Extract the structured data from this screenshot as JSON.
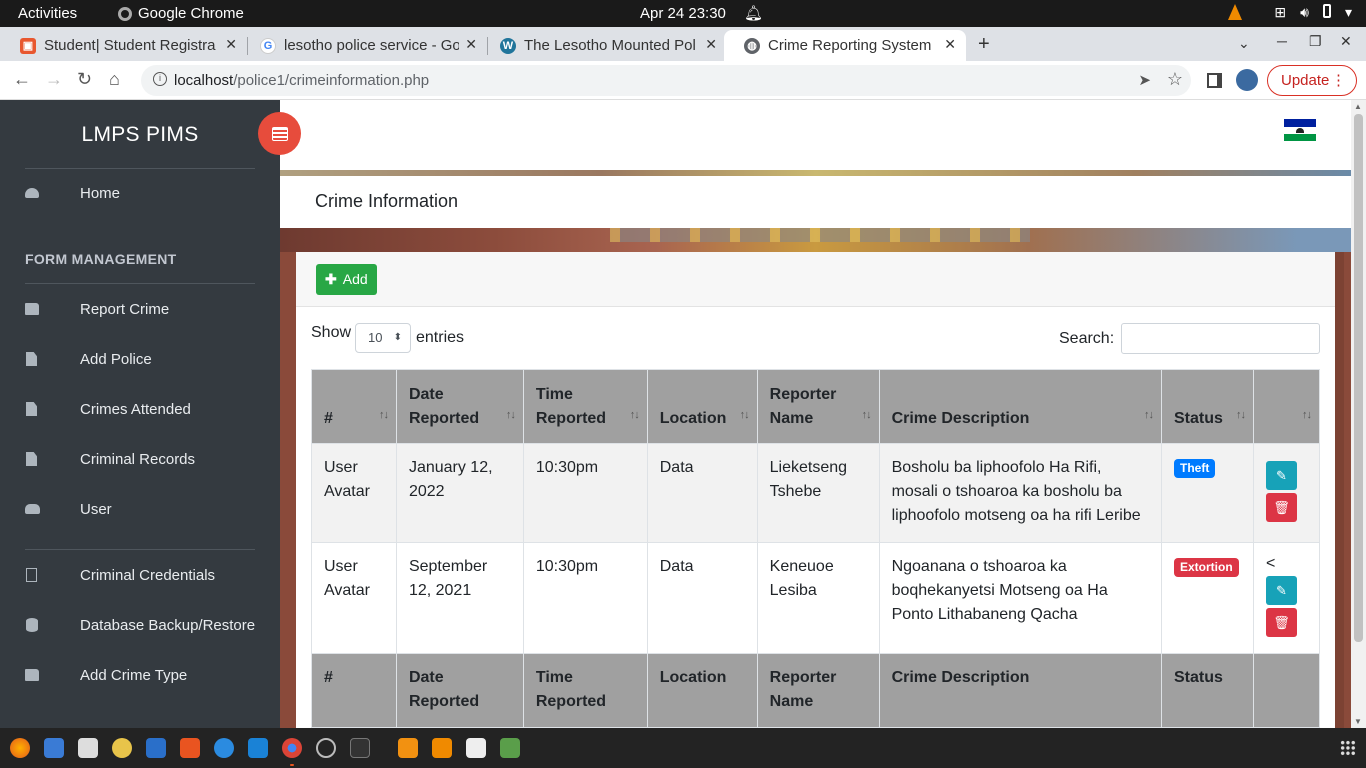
{
  "gnome": {
    "activities": "Activities",
    "app_name": "Google Chrome",
    "clock": "Apr 24  23:30"
  },
  "browser": {
    "tabs": [
      {
        "label": "Student| Student Registra",
        "favicon_color": "#e8572f"
      },
      {
        "label": "lesotho police service - Go",
        "favicon_color": "#4285f4"
      },
      {
        "label": "The Lesotho Mounted Pol",
        "favicon_color": "#21759b"
      },
      {
        "label": "Crime Reporting System",
        "favicon_color": "#5f6368"
      }
    ],
    "url_host": "localhost",
    "url_path": "/police1/crimeinformation.php",
    "update_label": "Update"
  },
  "sidebar": {
    "brand": "LMPS PIMS",
    "home": "Home",
    "section_header": "FORM MANAGEMENT",
    "items": [
      {
        "label": "Report Crime",
        "icon": "folder-icon"
      },
      {
        "label": "Add Police",
        "icon": "file-icon"
      },
      {
        "label": "Crimes Attended",
        "icon": "file-icon"
      },
      {
        "label": "Criminal Records",
        "icon": "file-icon"
      },
      {
        "label": "User",
        "icon": "users-icon"
      }
    ],
    "items2": [
      {
        "label": "Criminal Credentials",
        "icon": "file-outline-icon"
      },
      {
        "label": "Database Backup/Restore",
        "icon": "database-icon"
      },
      {
        "label": "Add Crime Type",
        "icon": "folder-icon"
      }
    ]
  },
  "page": {
    "title": "Crime Information",
    "add_label": "Add",
    "show_label": "Show",
    "length_value": "10",
    "entries_label": "entries",
    "search_label": "Search:",
    "search_value": ""
  },
  "table": {
    "columns": [
      "#",
      "Date Reported",
      "Time Reported",
      "Location",
      "Reporter Name",
      "Crime Description",
      "Status",
      ""
    ],
    "rows": [
      {
        "avatar_alt": "User Avatar",
        "date": "January 12, 2022",
        "time": "10:30pm",
        "location": "Data",
        "reporter": "Lieketseng Tshebe",
        "description": "Bosholu ba liphoofolo Ha Rifi, mosali o tshoaroa ka bosholu ba liphoofolo motseng oa ha rifi Leribe",
        "status": "Theft",
        "status_color": "#007bff"
      },
      {
        "avatar_alt": "User Avatar",
        "date": "September 12, 2021",
        "time": "10:30pm",
        "location": "Data",
        "reporter": "Keneuoe Lesiba",
        "description": "Ngoanana o tshoaroa ka boqhekanyetsi Motseng oa Ha Ponto Lithabaneng Qacha",
        "status": "Extortion",
        "status_color": "#dc3545",
        "stray_char": "<"
      }
    ],
    "footer_columns": [
      "#",
      "Date Reported",
      "Time Reported",
      "Location",
      "Reporter Name",
      "Crime Description",
      "Status",
      ""
    ]
  }
}
